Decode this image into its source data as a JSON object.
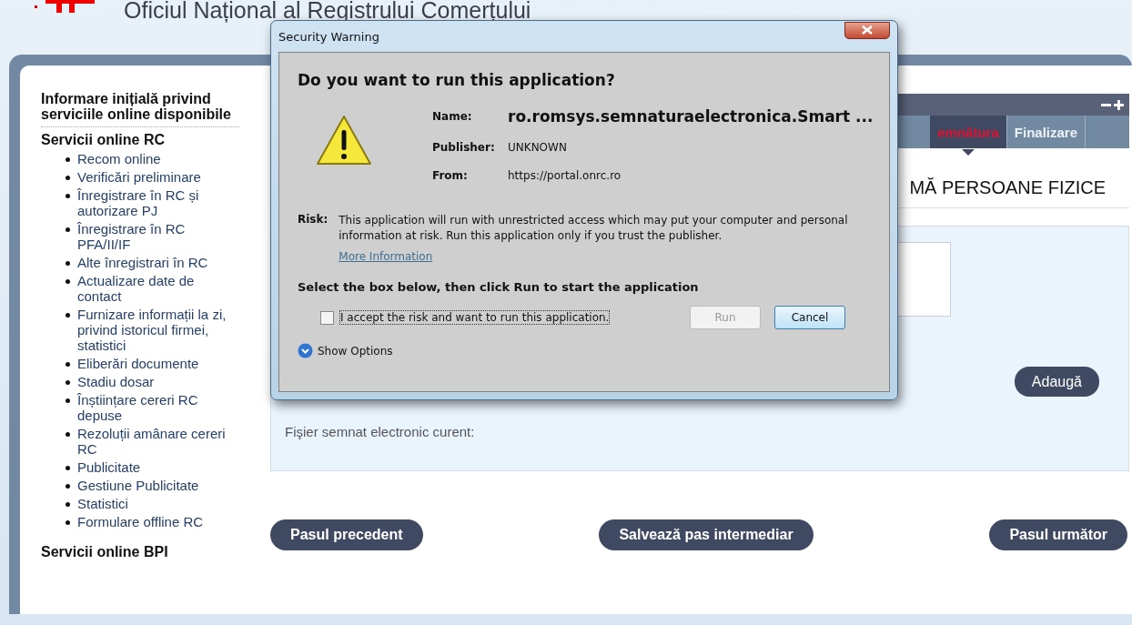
{
  "header": {
    "title": "Oficiul Național al Registrului Comerțului"
  },
  "sidebar": {
    "intro": "Informare inițială privind serviciile online disponibile",
    "sections": [
      {
        "title": "Servicii online RC",
        "items": [
          "Recom online",
          "Verificări preliminare",
          "Înregistrare în RC și autorizare PJ",
          "Înregistrare în RC PFA/II/IF",
          "Alte înregistrari în RC",
          "Actualizare date de contact",
          "Furnizare informații la zi, privind istoricul firmei, statistici",
          "Eliberări documente",
          "Stadiu dosar",
          "Înștiințare cereri RC depuse",
          "Rezoluții amânare cereri RC",
          "Publicitate",
          "Gestiune Publicitate",
          "Statistici",
          "Formulare offline RC"
        ]
      },
      {
        "title": "Servicii online BPI"
      }
    ]
  },
  "wizard": {
    "tabs": [
      {
        "label": "emnătura",
        "selected": true
      },
      {
        "label": "Finalizare",
        "selected": false
      }
    ],
    "heading": "MĂ PERSOANE FIZICE"
  },
  "form": {
    "add_button": "Adaugă",
    "current_file_label": "Fişier semnat electronic curent:"
  },
  "nav_buttons": [
    "Pasul precedent",
    "Salvează pas intermediar",
    "Pasul următor"
  ],
  "dialog": {
    "title": "Security Warning",
    "question": "Do you want to run this application?",
    "fields": [
      {
        "label": "Name:",
        "value": "ro.romsys.semnaturaelectronica.Smart ...",
        "kind": "primary"
      },
      {
        "label": "Publisher:",
        "value": "UNKNOWN",
        "kind": "plain"
      },
      {
        "label": "From:",
        "value": "https://portal.onrc.ro",
        "kind": "plain"
      }
    ],
    "risk_label": "Risk:",
    "risk_text": "This application will run with unrestricted access which may put your computer and personal information at risk. Run this application only if you trust the publisher.",
    "more_info": "More Information",
    "instruction": "Select the box below, then click Run to start the application",
    "checkbox": {
      "label": "I accept the risk and want to run this application.",
      "checked": false
    },
    "buttons": [
      {
        "label": "Run",
        "disabled": true
      },
      {
        "label": "Cancel",
        "disabled": false
      }
    ],
    "show_options": "Show Options"
  }
}
